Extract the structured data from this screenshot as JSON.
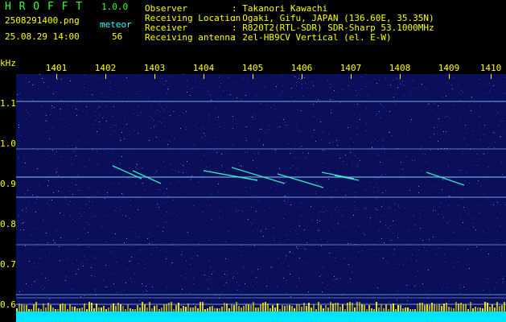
{
  "header": {
    "app_title": "H R O F F T",
    "version": "1.0.0",
    "filename": "2508291400.png",
    "datetime": "25.08.29 14:00",
    "meteor_label": "meteor",
    "meteor_count": "56",
    "info": [
      {
        "label": "Observer",
        "value": ": Takanori Kawachi"
      },
      {
        "label": "Receiving Location",
        "value": ": Ogaki, Gifu, JAPAN (136.60E, 35.35N)"
      },
      {
        "label": "Receiver",
        "value": ": R820T2(RTL-SDR) SDR-Sharp 53.1000MHz"
      },
      {
        "label": "Receiving antenna",
        "value": ": 2el-HB9CV Vertical (el. E-W)"
      }
    ]
  },
  "spectrogram": {
    "y_unit": "kHz",
    "x_ticks": [
      "1401",
      "1402",
      "1403",
      "1404",
      "1405",
      "1406",
      "1407",
      "1408",
      "1409",
      "1410"
    ],
    "y_ticks": [
      "1.1",
      "1.0",
      "0.9",
      "0.8",
      "0.7",
      "0.6"
    ],
    "colors": {
      "background": "#0b0f5a",
      "noise_line": "#7fb3ff",
      "meteor_trace": "#33ffcc",
      "bottom_signal": "#00e5ff",
      "bottom_yellow": "#ffff00"
    }
  }
}
